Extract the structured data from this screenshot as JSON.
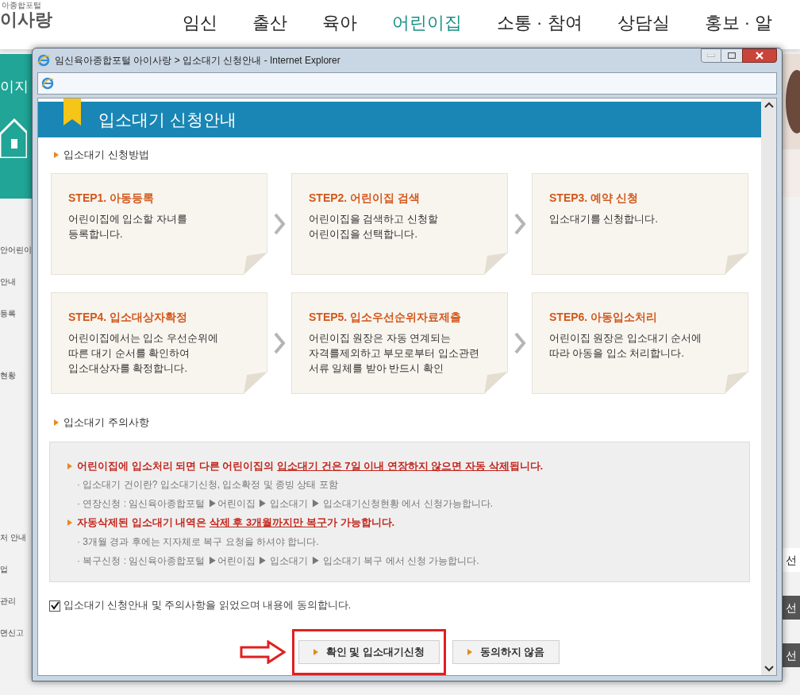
{
  "site": {
    "logo_small": "아종합포털",
    "logo": "이사랑",
    "nav": [
      {
        "label": "임신",
        "selected": false
      },
      {
        "label": "출산",
        "selected": false
      },
      {
        "label": "육아",
        "selected": false
      },
      {
        "label": "어린이집",
        "selected": true
      },
      {
        "label": "소통 · 참여",
        "selected": false
      },
      {
        "label": "상담실",
        "selected": false
      },
      {
        "label": "홍보 · 알",
        "selected": false
      }
    ],
    "banner_title": "이지",
    "side_menu": [
      "안어린이",
      "안내",
      "등록",
      "현황",
      "처 안내",
      "업",
      "관리",
      "면신고"
    ],
    "right_fragments": [
      "선",
      "선",
      "선"
    ]
  },
  "popup": {
    "title": "임신육아종합포털 아이사랑 > 입소대기 신청안내 - Internet Explorer",
    "header": "입소대기 신청안내",
    "method_heading": "입소대기 신청방법",
    "steps": [
      {
        "title": "STEP1. 아동등록",
        "text": "어린이집에 입소할 자녀를\n등록합니다."
      },
      {
        "title": "STEP2. 어린이집 검색",
        "text": "어린이집을 검색하고 신청할\n어린이집을 선택합니다."
      },
      {
        "title": "STEP3. 예약 신청",
        "text": "입소대기를 신청합니다."
      },
      {
        "title": "STEP4. 입소대상자확정",
        "text": "어린이집에서는 입소 우선순위에\n따른 대기 순서를 확인하여\n입소대상자를 확정합니다."
      },
      {
        "title": "STEP5. 입소우선순위자료제출",
        "text": "어린이집 원장은 자동 연계되는\n자격를제외하고 부모로부터 입소관련\n서류 일체를 받아 반드시 확인"
      },
      {
        "title": "STEP6. 아동입소처리",
        "text": "어린이집 원장은 입소대기 순서에\n따라 아동을 입소 처리합니다."
      }
    ],
    "notice_heading": "입소대기 주의사항",
    "notices": [
      {
        "kind": "warning",
        "segments": [
          {
            "text": "어린이집에 입소처리 되면 다른 어린이집의 ",
            "underlined": false
          },
          {
            "text": "입소대기 건은 7일 이내 연장하지 않으면 자동 삭제",
            "underlined": true
          },
          {
            "text": "됩니다.",
            "underlined": false
          }
        ]
      },
      {
        "kind": "note",
        "text": "· 입소대기 건이란? 입소대기신청, 입소확정 및 종빙 상태 포함"
      },
      {
        "kind": "note",
        "text": "· 연장신청 : 임신육아종합포털 ▶어린이집 ▶ 입소대기 ▶ 입소대기신청현황 에서 신청가능합니다."
      },
      {
        "kind": "warning",
        "segments": [
          {
            "text": "자동삭제된 입소대기 내역은 ",
            "underlined": false
          },
          {
            "text": "삭제 후 3개월까지만 복구",
            "underlined": true
          },
          {
            "text": "가 가능합니다.",
            "underlined": false
          }
        ]
      },
      {
        "kind": "note",
        "text": "· 3개월 경과 후에는 지자체로 복구 요청을 하셔야 합니다."
      },
      {
        "kind": "note",
        "text": "· 복구신청 : 임신육아종합포털 ▶어린이집 ▶ 입소대기 ▶ 입소대기 복구 에서 신청 가능합니다."
      }
    ],
    "agree": {
      "label": "입소대기 신청안내 및 주의사항을 읽었으며 내용에 동의합니다.",
      "checked": true
    },
    "buttons": [
      {
        "label": "확인 및 입소대기신청",
        "highlighted": true
      },
      {
        "label": "동의하지 않음",
        "highlighted": false
      }
    ]
  }
}
